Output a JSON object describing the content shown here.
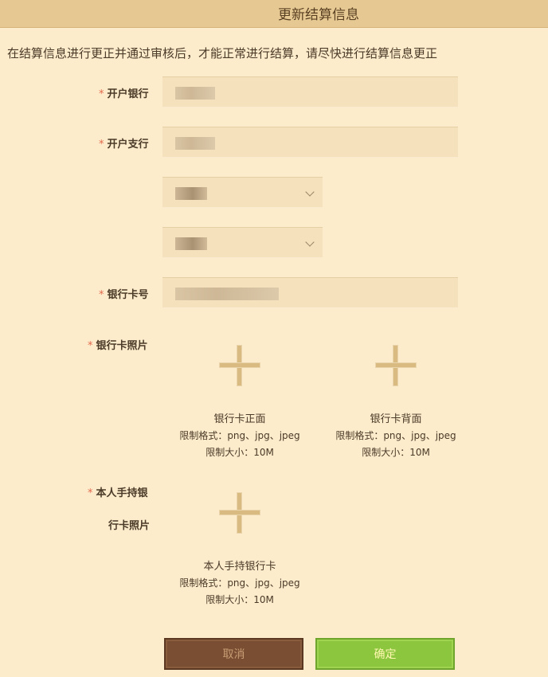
{
  "dialog": {
    "title": "更新结算信息",
    "notice": "在结算信息进行更正并通过审核后，才能正常进行结算，请尽快进行结算信息更正"
  },
  "form": {
    "required_mark": "*",
    "bank_label": "开户银行",
    "branch_label": "开户支行",
    "card_number_label": "银行卡号",
    "card_photo_label": "银行卡照片",
    "handheld_label_line1": "本人手持银",
    "handheld_label_line2": "行卡照片"
  },
  "uploads": {
    "front": {
      "title": "银行卡正面",
      "format": "限制格式：png、jpg、jpeg",
      "size": "限制大小：10M"
    },
    "back": {
      "title": "银行卡背面",
      "format": "限制格式：png、jpg、jpeg",
      "size": "限制大小：10M"
    },
    "handheld": {
      "title": "本人手持银行卡",
      "format": "限制格式：png、jpg、jpeg",
      "size": "限制大小：10M"
    }
  },
  "buttons": {
    "cancel": "取消",
    "confirm": "确定"
  },
  "icons": [
    "plus-icon",
    "chevron-down-icon"
  ],
  "colors": {
    "background": "#fdeccb",
    "titlebar": "#e6c992",
    "required": "#e26a4d",
    "cancel": "#7a4e32",
    "confirm": "#8cc63f"
  }
}
